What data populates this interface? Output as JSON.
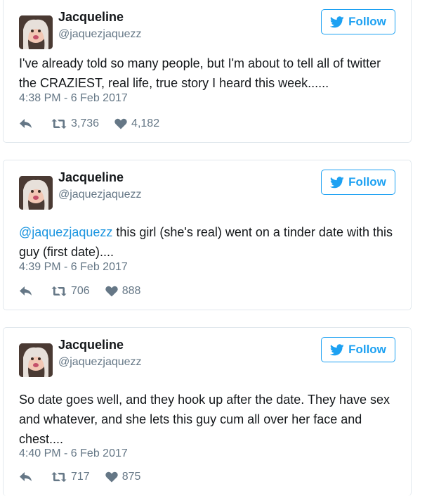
{
  "tweets": [
    {
      "name": "Jacqueline",
      "handle": "@jaquezjaquezz",
      "follow_label": "Follow",
      "mention": "",
      "text": "I've already told so many people, but I'm about to tell all of twitter the CRAZIEST, real life, true story I heard this week......",
      "timestamp": "4:38 PM - 6 Feb 2017",
      "retweets": "3,736",
      "likes": "4,182"
    },
    {
      "name": "Jacqueline",
      "handle": "@jaquezjaquezz",
      "follow_label": "Follow",
      "mention": "@jaquezjaquezz",
      "text": " this girl (she's real) went on a tinder date with this guy (first date)....",
      "timestamp": "4:39 PM - 6 Feb 2017",
      "retweets": "706",
      "likes": "888"
    },
    {
      "name": "Jacqueline",
      "handle": "@jaquezjaquezz",
      "follow_label": "Follow",
      "mention": "",
      "text": "So date goes well, and they hook up after the date. They have sex and whatever, and she lets this guy cum all over her face and chest....",
      "timestamp": "4:40 PM - 6 Feb 2017",
      "retweets": "717",
      "likes": "875"
    }
  ],
  "colors": {
    "accent": "#1da1f2",
    "mention": "#1b95e0",
    "muted": "#657786",
    "text": "#14171a",
    "border": "#e1e8ed"
  },
  "icons": {
    "follow": "twitter-bird-icon",
    "reply": "reply-arrow-icon",
    "retweet": "retweet-icon",
    "like": "heart-icon"
  }
}
